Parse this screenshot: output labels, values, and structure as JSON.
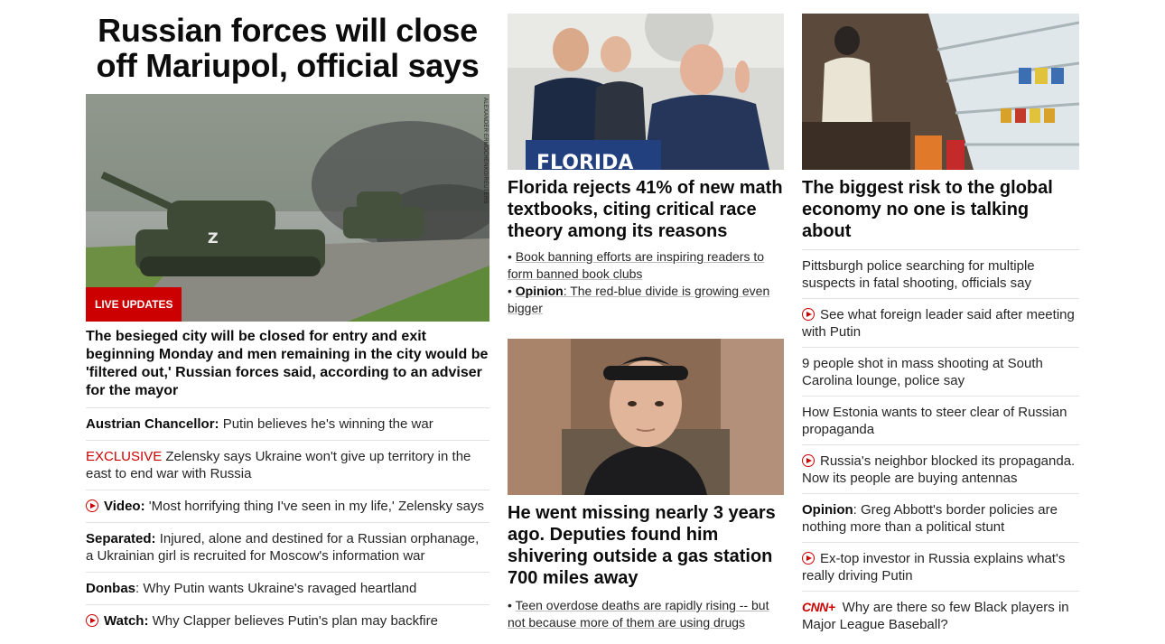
{
  "lead": {
    "title": "Russian forces will close off Mariupol, official says",
    "badge": "LIVE UPDATES",
    "photo_credit": "ALEXANDER ERMOCHENKO/REUTERS",
    "summary": "The besieged city will be closed for entry and exit beginning Monday and men remaining in the city would be 'filtered out,' Russian forces said, according to an adviser for the mayor",
    "items": [
      {
        "label": "Austrian Chancellor:",
        "text": " Putin believes he's winning the war",
        "style": "bold",
        "icon": ""
      },
      {
        "label": "EXCLUSIVE",
        "text": " Zelensky says Ukraine won't give up territory in the east to end war with Russia",
        "style": "exclusive",
        "icon": ""
      },
      {
        "label": "Video:",
        "text": " 'Most horrifying thing I've seen in my life,' Zelensky says",
        "style": "bold",
        "icon": "play-icon"
      },
      {
        "label": "Separated:",
        "text": " Injured, alone and destined for a Russian orphanage, a Ukrainian girl is recruited for Moscow's information war",
        "style": "bold",
        "icon": ""
      },
      {
        "label": "Donbas",
        "text": ": Why Putin wants Ukraine's ravaged heartland",
        "style": "bold",
        "icon": ""
      },
      {
        "label": "Watch:",
        "text": " Why Clapper believes Putin's plan may backfire",
        "style": "bold",
        "icon": "play-icon"
      }
    ]
  },
  "middle": {
    "card1": {
      "title": "Florida rejects 41% of new math textbooks, citing critical race theory among its reasons",
      "podium_text": "FLORIDA",
      "bullet1": "Book banning efforts are inspiring readers to form banned book clubs",
      "bullet2_label": "Opinion",
      "bullet2_text": ": The red-blue divide is growing even bigger"
    },
    "card2": {
      "title": "He went missing nearly 3 years ago. Deputies found him shivering outside a gas station 700 miles away",
      "bullet1": "Teen overdose deaths are rapidly rising -- but not because more of them are using drugs"
    }
  },
  "right": {
    "card_title": "The biggest risk to the global economy no one is talking about",
    "items": [
      {
        "label": "",
        "text": "Pittsburgh police searching for multiple suspects in fatal shooting, officials say",
        "icon": ""
      },
      {
        "label": "",
        "text": "See what foreign leader said after meeting with Putin",
        "icon": "play-icon"
      },
      {
        "label": "",
        "text": "9 people shot in mass shooting at South Carolina lounge, police say",
        "icon": ""
      },
      {
        "label": "",
        "text": "How Estonia wants to steer clear of Russian propaganda",
        "icon": ""
      },
      {
        "label": "",
        "text": "Russia's neighbor blocked its propaganda. Now its people are buying antennas",
        "icon": "play-icon"
      },
      {
        "label": "Opinion",
        "text": ": Greg Abbott's border policies are nothing more than a political stunt",
        "icon": ""
      },
      {
        "label": "",
        "text": "Ex-top investor in Russia explains what's really driving Putin",
        "icon": "play-icon"
      },
      {
        "label": "CNN+",
        "text": " Why are there so few Black players in Major League Baseball?",
        "icon": "cnn-plus-logo"
      }
    ]
  },
  "colors": {
    "accent": "#cc0000",
    "divider": "#e2e2e2",
    "text": "#0c0c0c"
  }
}
